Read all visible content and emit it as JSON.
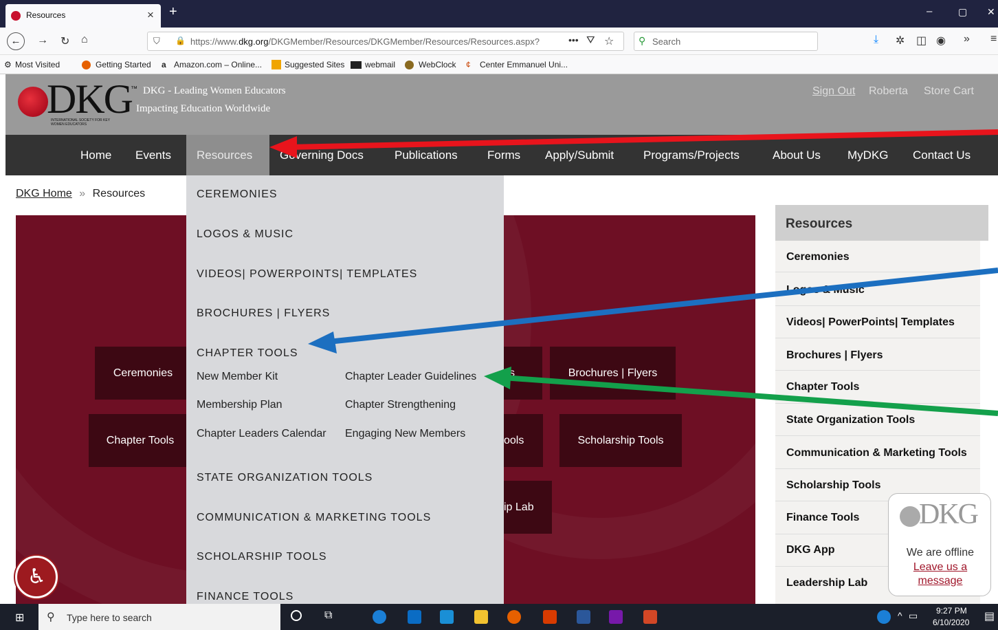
{
  "browser": {
    "tab_title": "Resources",
    "tab_close": "×",
    "new_tab": "+",
    "url_prefix": "https://www.",
    "url_domain": "dkg.org",
    "url_path": "/DKGMember/Resources/DKGMember/Resources/Resources.aspx?",
    "search_placeholder": "Search",
    "window_min": "–",
    "window_max": "▢",
    "window_close": "✕",
    "bookmarks": [
      "Most Visited",
      "Getting Started",
      "Amazon.com – Online...",
      "Suggested Sites",
      "webmail",
      "WebClock",
      "Center Emmanuel Uni..."
    ]
  },
  "site": {
    "logo_text": "DKG",
    "logo_small": "INTERNATIONAL SOCIETY FOR KEY WOMEN EDUCATORS",
    "tm": "™",
    "tagline1": "DKG - Leading Women Educators",
    "tagline2": "Impacting Education Worldwide",
    "account": {
      "sign_out": "Sign Out",
      "user": "Roberta",
      "store": "Store Cart"
    },
    "nav": [
      "Home",
      "Events",
      "Resources",
      "Governing Docs",
      "Publications",
      "Forms",
      "Apply/Submit",
      "Programs/Projects",
      "About Us",
      "MyDKG",
      "Contact Us"
    ],
    "breadcrumb": {
      "home": "DKG Home",
      "sep": "»",
      "current": "Resources"
    }
  },
  "dropdown": {
    "ceremonies": "CEREMONIES",
    "logos": "LOGOS & MUSIC",
    "videos": "VIDEOS| POWERPOINTS| TEMPLATES",
    "brochures": "BROCHURES | FLYERS",
    "chapter_tools": "CHAPTER TOOLS",
    "chapter_links": [
      "New Member Kit",
      "Chapter Leader Guidelines",
      "Membership Plan",
      "Chapter Strengthening",
      "Chapter Leaders Calendar",
      "Engaging New Members"
    ],
    "state": "STATE ORGANIZATION TOOLS",
    "comm": "COMMUNICATION & MARKETING TOOLS",
    "scholarship": "SCHOLARSHIP TOOLS",
    "finance": "FINANCE TOOLS"
  },
  "tiles": {
    "ceremonies": "Ceremonies",
    "brochures": "Brochures | Flyers",
    "chapter": "Chapter Tools",
    "scholarship": "Scholarship Tools",
    "partial_s": "s",
    "partial_tools": "ools",
    "partial_lab": "ip Lab"
  },
  "sidebar": {
    "title": "Resources",
    "items": [
      "Ceremonies",
      "Logos & Music",
      "Videos| PowerPoints| Templates",
      "Brochures | Flyers",
      "Chapter Tools",
      "State Organization Tools",
      "Communication & Marketing Tools",
      "Scholarship Tools",
      "Finance Tools",
      "DKG App",
      "Leadership Lab"
    ]
  },
  "chat": {
    "logo": "DKG",
    "status": "We are offline",
    "link": "Leave us a message"
  },
  "taskbar": {
    "search_placeholder": "Type here to search",
    "time": "9:27 PM",
    "date": "6/10/2020"
  },
  "colors": {
    "annotation_red": "#e8141c",
    "annotation_blue": "#1c6fc0",
    "annotation_green": "#13a04b",
    "banner": "#6e0f24",
    "nav_bg": "#333333"
  }
}
